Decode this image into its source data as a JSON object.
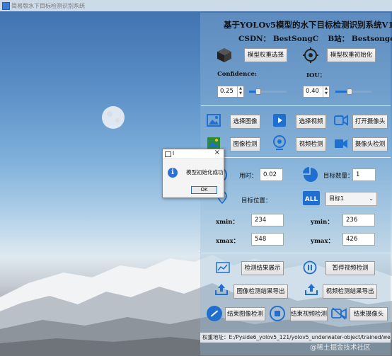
{
  "window": {
    "title": "简易版水下目标检测识别系统"
  },
  "header": {
    "title": "基于YOLOv5模型的水下目标检测识别系统V1.0",
    "csdn_label": "CSDN：",
    "csdn_value": "BestSongC",
    "bili_label": "B站：",
    "bili_value": "Bestsongc"
  },
  "model": {
    "select_label": "模型权重选择",
    "init_label": "模型权重初始化"
  },
  "params": {
    "confidence_label": "Confidence:",
    "confidence_value": "0.25",
    "confidence_level": 0.25,
    "iou_label": "IOU：",
    "iou_value": "0.40",
    "iou_level": 0.4
  },
  "media": {
    "select_image": "选择图像",
    "select_video": "选择视频",
    "open_camera": "打开摄像头",
    "image_detect": "图像检测",
    "video_detect": "视频检测",
    "camera_detect": "摄像头检测"
  },
  "results": {
    "time_label": "用时：",
    "time_value": "0.02",
    "count_label": "目标数量：",
    "count_value": "1",
    "position_label": "目标位置：",
    "target_select": "目标1",
    "xmin_label": "xmin：",
    "xmin_value": "234",
    "ymin_label": "ymin：",
    "ymin_value": "236",
    "xmax_label": "xmax：",
    "xmax_value": "548",
    "ymax_label": "ymax：",
    "ymax_value": "426"
  },
  "actions": {
    "show_result": "检测结果展示",
    "pause_video": "暂停视频检测",
    "export_image": "图像检测结果导出",
    "export_video": "视频检测结果导出",
    "end_image": "结束图像检测",
    "end_video": "结束视频检测",
    "end_camera": "结束摄像头"
  },
  "status": {
    "text": "权重地址：E:/Pyside6_yolov5_121/yolov5_underwater-object/trained/weights/best.pt"
  },
  "dialog": {
    "title": "I",
    "message": "模型初始化成功",
    "ok": "OK"
  },
  "watermark": "@稀土掘金技术社区",
  "colors": {
    "accent": "#1f6fd0",
    "panel_text": "#111111"
  }
}
